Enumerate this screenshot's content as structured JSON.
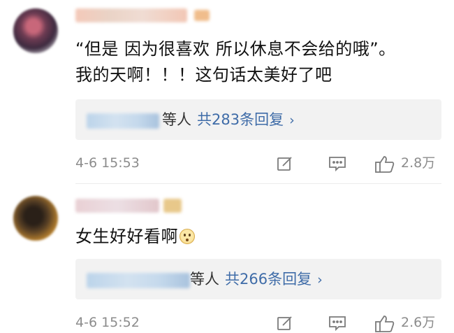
{
  "comments": [
    {
      "text_line1": "“但是 因为很喜欢 所以休息不会给的哦”。",
      "text_line2": "我的天啊！！！这句话太美好了吧",
      "reply_who": "等人",
      "reply_count": "共283条回复",
      "reply_arrow": "›",
      "time": "4-6 15:53",
      "likes": "2.8万"
    },
    {
      "text_line1": "女生好好看啊",
      "emoji": "pleading-face-emoji",
      "reply_who": "等人",
      "reply_count": "共266条回复",
      "reply_arrow": "›",
      "time": "4-6 15:52",
      "likes": "2.6万"
    }
  ],
  "icons": [
    "edit-icon",
    "comment-icon",
    "like-icon"
  ],
  "colors": {
    "link": "#3f6ca8",
    "meta": "#8c8c8c",
    "reply_bg": "#f2f2f2"
  }
}
